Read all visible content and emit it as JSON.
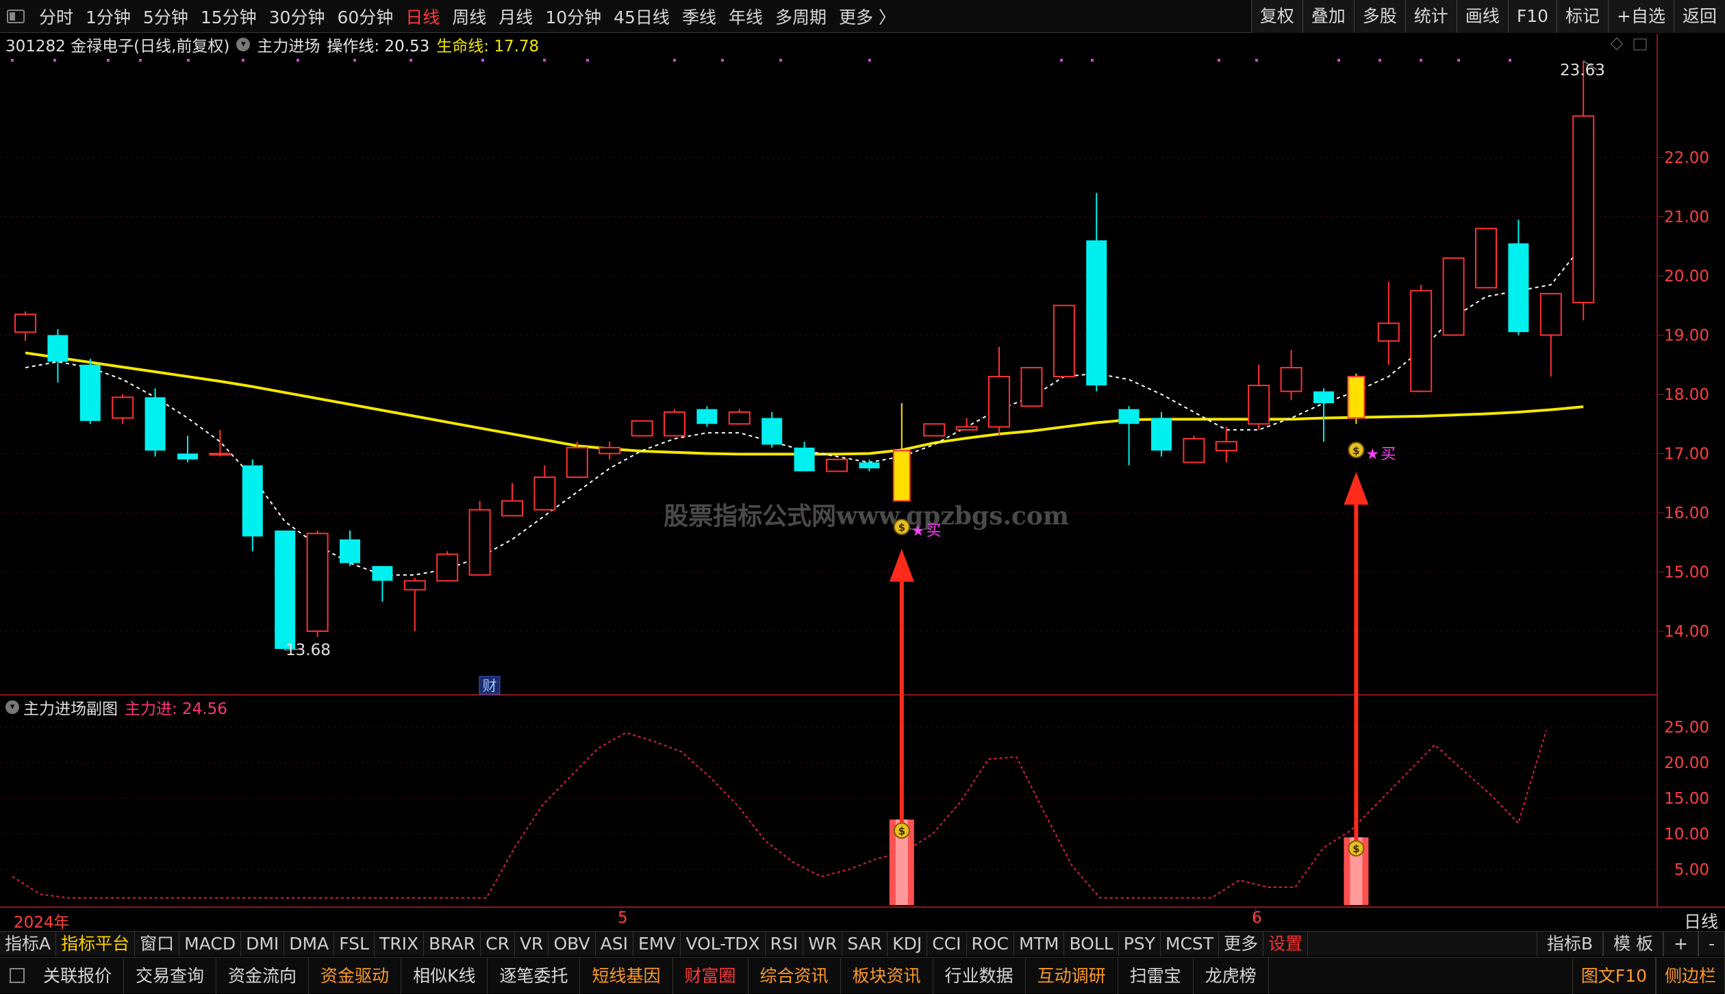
{
  "top_menu": [
    "分时",
    "1分钟",
    "5分钟",
    "15分钟",
    "30分钟",
    "60分钟",
    "日线",
    "周线",
    "月线",
    "10分钟",
    "45日线",
    "季线",
    "年线",
    "多周期",
    "更多 〉"
  ],
  "top_menu_active": "日线",
  "top_right": [
    "复权",
    "叠加",
    "多股",
    "统计",
    "画线",
    "F10",
    "标记",
    "+自选",
    "返回"
  ],
  "stock_title": "301282 金禄电子(日线,前复权)",
  "indicator_name": "主力进场",
  "op_line": "操作线: 20.53",
  "life_line": "生命线: 17.78",
  "price_axis": [
    "22.00",
    "21.00",
    "20.00",
    "19.00",
    "18.00",
    "17.00",
    "16.00",
    "15.00",
    "14.00"
  ],
  "high_label": "23.63",
  "low_label": "13.68",
  "buy_label": "买",
  "cai_badge": "财",
  "watermark": "股票指标公式网www.gpzbgs.com",
  "sub_title": "主力进场副图",
  "sub_value": "主力进: 24.56",
  "sub_axis": [
    "25.00",
    "20.00",
    "15.00",
    "10.00",
    "5.00"
  ],
  "dates": [
    "2024年",
    "5",
    "6"
  ],
  "period_label": "日线",
  "indicator_tabs": [
    "指标A",
    "指标平台",
    "窗口",
    "MACD",
    "DMI",
    "DMA",
    "FSL",
    "TRIX",
    "BRAR",
    "CR",
    "VR",
    "OBV",
    "ASI",
    "EMV",
    "VOL-TDX",
    "RSI",
    "WR",
    "SAR",
    "KDJ",
    "CCI",
    "ROC",
    "MTM",
    "BOLL",
    "PSY",
    "MCST",
    "更多",
    "设置"
  ],
  "indicator_tabs_right": [
    "指标B",
    "模 板",
    "+",
    "-"
  ],
  "footer_tabs": [
    "关联报价",
    "交易查询",
    "资金流向",
    "资金驱动",
    "相似K线",
    "逐笔委托",
    "短线基因",
    "财富圈",
    "综合资讯",
    "板块资讯",
    "行业数据",
    "互动调研",
    "扫雷宝",
    "龙虎榜"
  ],
  "footer_right": [
    "图文F10",
    "侧边栏"
  ],
  "colors": {
    "up": "#ff3232",
    "down": "#00f0f0",
    "life": "#f5e800",
    "signal": "#ffe000",
    "accent_red": "#ff3030"
  },
  "chart_data": {
    "type": "candlestick",
    "candles": [
      {
        "o": 19.05,
        "h": 19.4,
        "l": 18.9,
        "c": 19.35
      },
      {
        "o": 19.0,
        "h": 19.1,
        "l": 18.2,
        "c": 18.55
      },
      {
        "o": 18.5,
        "h": 18.6,
        "l": 17.5,
        "c": 17.55
      },
      {
        "o": 17.6,
        "h": 18.0,
        "l": 17.5,
        "c": 17.95
      },
      {
        "o": 17.95,
        "h": 18.1,
        "l": 16.95,
        "c": 17.05
      },
      {
        "o": 17.0,
        "h": 17.3,
        "l": 16.85,
        "c": 16.9
      },
      {
        "o": 17.0,
        "h": 17.4,
        "l": 16.95,
        "c": 17.0
      },
      {
        "o": 16.8,
        "h": 16.9,
        "l": 15.35,
        "c": 15.6
      },
      {
        "o": 15.7,
        "h": 15.7,
        "l": 13.68,
        "c": 13.7
      },
      {
        "o": 14.0,
        "h": 15.7,
        "l": 13.9,
        "c": 15.65
      },
      {
        "o": 15.55,
        "h": 15.7,
        "l": 15.1,
        "c": 15.15
      },
      {
        "o": 15.1,
        "h": 15.1,
        "l": 14.5,
        "c": 14.85
      },
      {
        "o": 14.7,
        "h": 14.9,
        "l": 14.0,
        "c": 14.85
      },
      {
        "o": 14.85,
        "h": 15.35,
        "l": 14.85,
        "c": 15.3
      },
      {
        "o": 14.95,
        "h": 16.2,
        "l": 14.95,
        "c": 16.05
      },
      {
        "o": 15.95,
        "h": 16.5,
        "l": 15.95,
        "c": 16.2
      },
      {
        "o": 16.05,
        "h": 16.8,
        "l": 16.05,
        "c": 16.6
      },
      {
        "o": 16.6,
        "h": 17.2,
        "l": 16.6,
        "c": 17.1
      },
      {
        "o": 17.0,
        "h": 17.2,
        "l": 16.9,
        "c": 17.1
      },
      {
        "o": 17.3,
        "h": 17.55,
        "l": 17.3,
        "c": 17.55
      },
      {
        "o": 17.3,
        "h": 17.75,
        "l": 17.3,
        "c": 17.7
      },
      {
        "o": 17.75,
        "h": 17.8,
        "l": 17.45,
        "c": 17.5
      },
      {
        "o": 17.5,
        "h": 17.75,
        "l": 17.5,
        "c": 17.7
      },
      {
        "o": 17.6,
        "h": 17.7,
        "l": 17.1,
        "c": 17.15
      },
      {
        "o": 17.1,
        "h": 17.2,
        "l": 16.7,
        "c": 16.7
      },
      {
        "o": 16.7,
        "h": 16.9,
        "l": 16.7,
        "c": 16.9
      },
      {
        "o": 16.85,
        "h": 16.9,
        "l": 16.7,
        "c": 16.75
      },
      {
        "o": 16.2,
        "h": 17.85,
        "l": 16.2,
        "c": 17.05
      },
      {
        "o": 17.3,
        "h": 17.5,
        "l": 17.3,
        "c": 17.5
      },
      {
        "o": 17.4,
        "h": 17.6,
        "l": 17.4,
        "c": 17.45
      },
      {
        "o": 17.45,
        "h": 18.8,
        "l": 17.3,
        "c": 18.3
      },
      {
        "o": 17.8,
        "h": 18.45,
        "l": 17.8,
        "c": 18.45
      },
      {
        "o": 18.3,
        "h": 19.5,
        "l": 18.3,
        "c": 19.5
      },
      {
        "o": 20.6,
        "h": 21.4,
        "l": 18.05,
        "c": 18.15
      },
      {
        "o": 17.75,
        "h": 17.8,
        "l": 16.8,
        "c": 17.5
      },
      {
        "o": 17.6,
        "h": 17.7,
        "l": 16.95,
        "c": 17.05
      },
      {
        "o": 16.85,
        "h": 17.3,
        "l": 16.85,
        "c": 17.25
      },
      {
        "o": 17.05,
        "h": 17.45,
        "l": 16.85,
        "c": 17.2
      },
      {
        "o": 17.5,
        "h": 18.5,
        "l": 17.4,
        "c": 18.15
      },
      {
        "o": 18.05,
        "h": 18.75,
        "l": 17.9,
        "c": 18.45
      },
      {
        "o": 18.05,
        "h": 18.1,
        "l": 17.2,
        "c": 17.85
      },
      {
        "o": 17.6,
        "h": 18.35,
        "l": 17.5,
        "c": 18.3
      },
      {
        "o": 18.9,
        "h": 19.9,
        "l": 18.5,
        "c": 19.2
      },
      {
        "o": 18.05,
        "h": 19.85,
        "l": 18.05,
        "c": 19.75
      },
      {
        "o": 19.0,
        "h": 20.3,
        "l": 19.0,
        "c": 20.3
      },
      {
        "o": 19.8,
        "h": 20.8,
        "l": 19.8,
        "c": 20.8
      },
      {
        "o": 20.55,
        "h": 20.95,
        "l": 19.0,
        "c": 19.05
      },
      {
        "o": 19.0,
        "h": 19.7,
        "l": 18.3,
        "c": 19.7
      },
      {
        "o": 19.55,
        "h": 23.63,
        "l": 19.25,
        "c": 22.7
      }
    ],
    "life_line": [
      18.7,
      18.62,
      18.54,
      18.46,
      18.38,
      18.3,
      18.22,
      18.13,
      18.03,
      17.93,
      17.83,
      17.73,
      17.63,
      17.53,
      17.43,
      17.33,
      17.23,
      17.13,
      17.08,
      17.04,
      17.02,
      17.0,
      16.99,
      16.99,
      16.99,
      16.99,
      17.0,
      17.06,
      17.18,
      17.26,
      17.33,
      17.38,
      17.45,
      17.52,
      17.57,
      17.58,
      17.58,
      17.58,
      17.58,
      17.58,
      17.6,
      17.61,
      17.62,
      17.63,
      17.65,
      17.67,
      17.7,
      17.74,
      17.79
    ],
    "op_line": [
      18.45,
      18.55,
      18.45,
      18.25,
      17.95,
      17.6,
      17.2,
      16.6,
      15.85,
      15.45,
      15.15,
      14.95,
      14.95,
      15.05,
      15.25,
      15.55,
      15.95,
      16.35,
      16.75,
      17.05,
      17.25,
      17.35,
      17.35,
      17.2,
      17.05,
      16.95,
      16.85,
      16.95,
      17.15,
      17.45,
      17.75,
      17.95,
      18.3,
      18.35,
      18.25,
      18.0,
      17.7,
      17.4,
      17.4,
      17.6,
      17.85,
      18.05,
      18.3,
      18.75,
      19.3,
      19.65,
      19.75,
      19.85,
      20.53
    ],
    "buy_signals": [
      27,
      41
    ],
    "sub_line": [
      4,
      1.5,
      1,
      1,
      1,
      1,
      1,
      1,
      1,
      1,
      1,
      1,
      1,
      1,
      1,
      1,
      1,
      1,
      8,
      14,
      18,
      22,
      24.2,
      23,
      21.5,
      18,
      14,
      9,
      6,
      4,
      5,
      6.5,
      7.5,
      10,
      14.5,
      20.5,
      20.8,
      13,
      5.5,
      1,
      1,
      1,
      1,
      1,
      3.5,
      2.5,
      2.5,
      8,
      10.5,
      14.5,
      18.5,
      22.5,
      19,
      15.5,
      11.5,
      24.56
    ],
    "sub_bars": [
      {
        "index": 27,
        "value": 12
      },
      {
        "index": 41,
        "value": 9.5
      }
    ],
    "y_range": [
      13.2,
      24.0
    ],
    "sub_range": [
      0,
      28
    ]
  }
}
